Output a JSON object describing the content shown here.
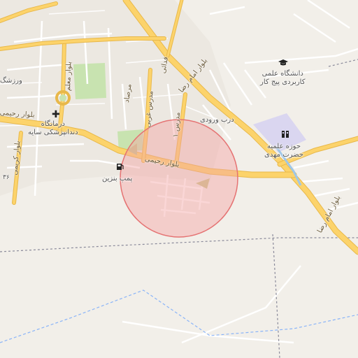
{
  "map": {
    "labels": {
      "dentistry_clinic": "درمانگاه\nدندانپزشکی سایه",
      "gas_station": "پمپ بنزین",
      "university": "دانشگاه علمی\nکاربردی پیج کار",
      "seminary": "حوزه علمیه\nحضرت مهدی",
      "entrance_gate": "درب ورودی",
      "varzeshgah": "ورزشگ",
      "num_label": "۳۶"
    },
    "roads": {
      "imam_reza_upper": "بلوار امام رضا",
      "imam_reza_lower": "بلوار امام رضا",
      "rahimi": "بلوار رحیمی",
      "rahimi_left": "بلوار رحیمی",
      "moalem": "بلوار معلم",
      "karimi": "بلوار کریمی",
      "modarres_west": "مدرس غربی",
      "modarres_1": "مدرس ۱",
      "mokhtar": "مرصاد",
      "fadaii": "فدائی"
    },
    "icons": {
      "hospital": "hospital-cross-icon",
      "fuel": "fuel-pump-icon",
      "graduation": "graduation-cap-icon",
      "building": "building-icon"
    },
    "colors": {
      "background": "#f2efe9",
      "major_road": "#fcd36b",
      "minor_road": "#ffffff",
      "park": "#c8e3b0",
      "campus": "#dad6f0",
      "circle_fill": "#f4a3a3",
      "circle_stroke": "#e57373",
      "water": "#8ab4f8"
    }
  }
}
